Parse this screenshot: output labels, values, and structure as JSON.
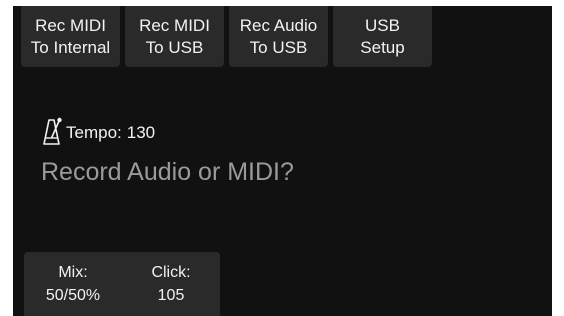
{
  "top_buttons": [
    {
      "line1": "Rec MIDI",
      "line2": "To Internal"
    },
    {
      "line1": "Rec MIDI",
      "line2": "To USB"
    },
    {
      "line1": "Rec Audio",
      "line2": "To USB"
    },
    {
      "line1": "USB",
      "line2": "Setup"
    }
  ],
  "tempo": {
    "label": "Tempo:",
    "value": "130",
    "icon": "metronome-icon"
  },
  "prompt": "Record Audio or MIDI?",
  "bottom": {
    "mix": {
      "label": "Mix:",
      "value": "50/50%"
    },
    "click": {
      "label": "Click:",
      "value": "105"
    }
  },
  "colors": {
    "background": "#111111",
    "button": "#2a2a2a",
    "text": "#f2f2f2",
    "prompt": "#9a9a9a"
  }
}
